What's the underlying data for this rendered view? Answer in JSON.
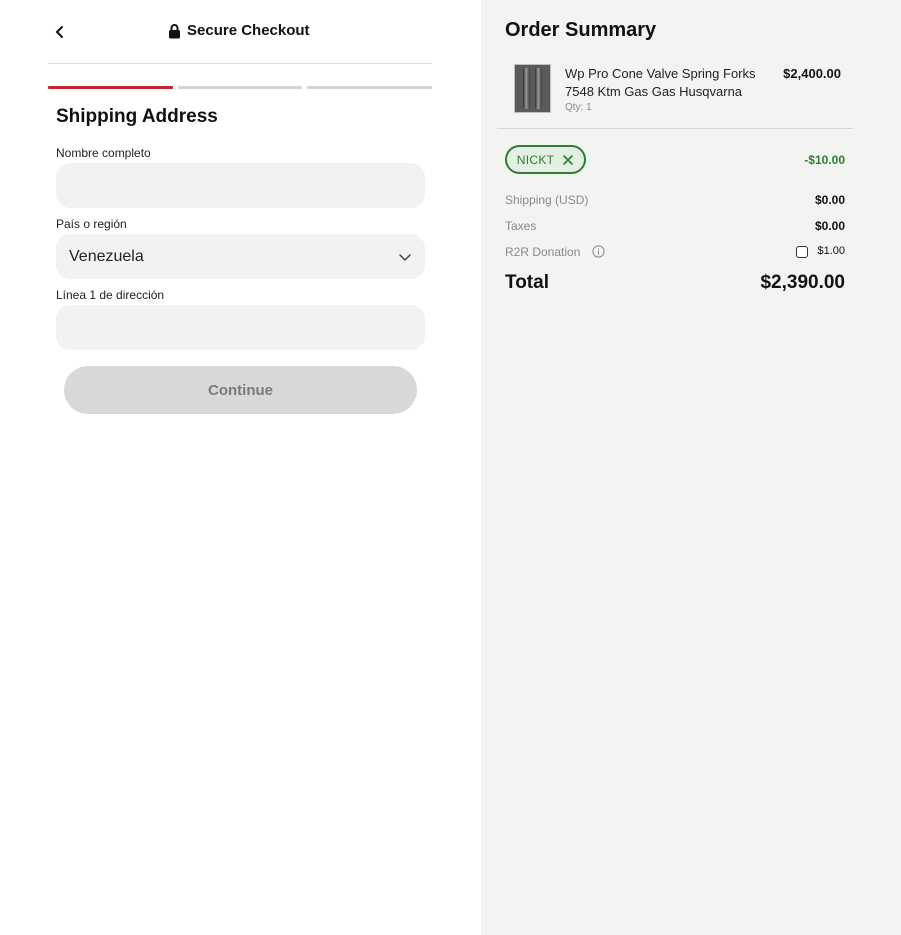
{
  "header": {
    "back_icon": "chevron-left-icon",
    "lock_icon": "lock-icon",
    "title": "Secure Checkout"
  },
  "steps": {
    "count": 3,
    "active_index": 0,
    "active_color": "#c0262d"
  },
  "shipping": {
    "title": "Shipping Address",
    "full_name": {
      "label": "Nombre completo",
      "value": ""
    },
    "country": {
      "label": "País o región",
      "value": "Venezuela"
    },
    "address1": {
      "label": "Línea 1 de dirección",
      "value": ""
    },
    "continue_label": "Continue"
  },
  "summary": {
    "title": "Order Summary",
    "item": {
      "name": "Wp Pro Cone Valve Spring Forks 7548 Ktm Gas Gas Husqvarna",
      "qty": "Qty: 1",
      "price": "$2,400.00"
    },
    "coupon": {
      "code": "NICKT",
      "discount": "-$10.00",
      "color": "#2f7d32"
    },
    "shipping_label": "Shipping (USD)",
    "shipping_value": "$0.00",
    "taxes_label": "Taxes",
    "taxes_value": "$0.00",
    "donation_label": "R2R Donation",
    "donation_value": "$1.00",
    "donation_checked": false,
    "total_label": "Total",
    "total_value": "$2,390.00"
  }
}
